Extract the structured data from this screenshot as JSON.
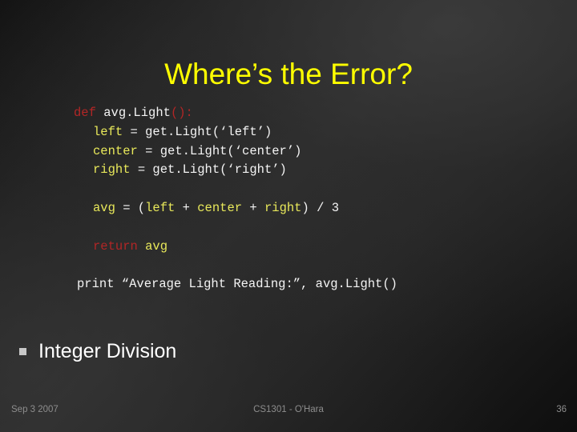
{
  "slide": {
    "title": "Where’s the Error?",
    "title_color": "#ffff00",
    "background_colors": [
      "#101010",
      "#2c2c2c",
      "#0e0e0e"
    ]
  },
  "code": {
    "font": "monospace",
    "colors": {
      "default": "#f4f4f4",
      "keyword": "#b22626",
      "variable": "#e8e85a"
    },
    "lines": [
      {
        "indent": 92,
        "tokens": [
          {
            "text": "def",
            "color": "keyword"
          },
          {
            "text": " ",
            "color": "default"
          },
          {
            "text": "avg.Light",
            "color": "default"
          },
          {
            "text": "():",
            "color": "keyword"
          }
        ]
      },
      {
        "indent": 116,
        "tokens": [
          {
            "text": "left",
            "color": "variable"
          },
          {
            "text": " = get.Light(‘left’)",
            "color": "default"
          }
        ]
      },
      {
        "indent": 116,
        "tokens": [
          {
            "text": "center",
            "color": "variable"
          },
          {
            "text": " = get.Light(‘center’)",
            "color": "default"
          }
        ]
      },
      {
        "indent": 116,
        "tokens": [
          {
            "text": "right",
            "color": "variable"
          },
          {
            "text": " = get.Light(‘right’)",
            "color": "default"
          }
        ]
      },
      {
        "indent": 0,
        "tokens": []
      },
      {
        "indent": 116,
        "tokens": [
          {
            "text": "avg",
            "color": "variable"
          },
          {
            "text": " = (",
            "color": "default"
          },
          {
            "text": "left",
            "color": "variable"
          },
          {
            "text": " + ",
            "color": "default"
          },
          {
            "text": "center",
            "color": "variable"
          },
          {
            "text": " + ",
            "color": "default"
          },
          {
            "text": "right",
            "color": "variable"
          },
          {
            "text": ") / 3",
            "color": "default"
          }
        ]
      },
      {
        "indent": 0,
        "tokens": []
      },
      {
        "indent": 116,
        "tokens": [
          {
            "text": "return",
            "color": "keyword"
          },
          {
            "text": " ",
            "color": "default"
          },
          {
            "text": "avg",
            "color": "variable"
          }
        ]
      },
      {
        "indent": 0,
        "tokens": []
      },
      {
        "indent": 96,
        "tokens": [
          {
            "text": "print “Average Light Reading:”, avg.Light()",
            "color": "default"
          }
        ]
      }
    ]
  },
  "bullets": [
    {
      "marker": "square-bullet",
      "label": "Integer Division"
    }
  ],
  "footer": {
    "date": "Sep 3 2007",
    "course": "CS1301 - O'Hara",
    "page_number": "36"
  }
}
